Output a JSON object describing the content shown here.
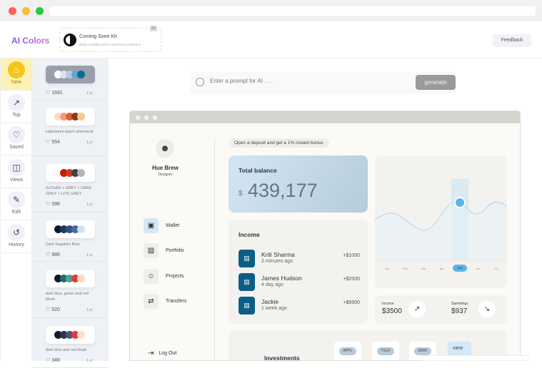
{
  "app": {
    "brand": "AI Colors",
    "feedback_label": "Feedback"
  },
  "ad": {
    "title": "Coming Soon Kit",
    "subtitle": "Build a Waitlist before launching products 2",
    "tag": "Ad"
  },
  "nav": [
    {
      "label": "New",
      "icon": "cake-icon",
      "active": true
    },
    {
      "label": "Top",
      "icon": "trending-up-icon"
    },
    {
      "label": "Saved",
      "icon": "heart-icon"
    },
    {
      "label": "Views",
      "icon": "views-icon"
    },
    {
      "label": "Edit",
      "icon": "pencil-icon"
    },
    {
      "label": "History",
      "icon": "history-icon"
    }
  ],
  "palettes": [
    {
      "name": "",
      "likes": "1691",
      "age": "1 yr",
      "colors": [
        "#ffffff",
        "#d9e6ef",
        "#b3cde0",
        "#5ea8d6",
        "#0a6a93"
      ]
    },
    {
      "name": "Halloween warm whimsical",
      "likes": "554",
      "age": "1 yr",
      "colors": [
        "#f6dcc4",
        "#f0a070",
        "#e0603a",
        "#8a3a18",
        "#f6c890"
      ]
    },
    {
      "name": "#c21d03 + GREY + DARK GREY + LITE GREY",
      "likes": "398",
      "age": "1 yr",
      "colors": [
        "#fbf4f4",
        "#c21d03",
        "#d03a20",
        "#404040",
        "#b5b5b5"
      ]
    },
    {
      "name": "Dark Sapphire Blue",
      "likes": "986",
      "age": "1 yr",
      "colors": [
        "#0f1b2d",
        "#1f3a5f",
        "#34507e",
        "#4a6a9a",
        "#cfe3f7"
      ]
    },
    {
      "name": "dark blue, green and red blush",
      "likes": "520",
      "age": "1 yr",
      "colors": [
        "#0f1b2d",
        "#1b6e6a",
        "#4aa39a",
        "#e53935",
        "#fbd9c0"
      ]
    },
    {
      "name": "dark blue and red blush",
      "likes": "346",
      "age": "1 yr",
      "colors": [
        "#141b2b",
        "#2a3550",
        "#4a5570",
        "#e53935",
        "#fbe0cc"
      ]
    }
  ],
  "prompt": {
    "placeholder": "Enter a prompt for AI . . .",
    "button": "generate"
  },
  "mockup": {
    "profile": {
      "name": "Hue Brew",
      "role": "Designer"
    },
    "menu": [
      {
        "label": "Wallet",
        "icon": "wallet-icon",
        "active": true
      },
      {
        "label": "Portfolio",
        "icon": "chart-icon"
      },
      {
        "label": "Projects",
        "icon": "projects-icon"
      },
      {
        "label": "Transfers",
        "icon": "transfers-icon"
      }
    ],
    "logout": "Log Out",
    "promo": "Open a deposit and get a 1% instant bonus",
    "balance": {
      "title": "Total balance",
      "currency": "$",
      "amount": "439,177"
    },
    "income": {
      "title": "Income",
      "items": [
        {
          "name": "Kriti Sharma",
          "time": "2 minutes ago",
          "amount": "+$1000"
        },
        {
          "name": "James Hudson",
          "time": "4 day ago",
          "amount": "+$2500"
        },
        {
          "name": "Jackie",
          "time": "1 week ago",
          "amount": "+$6900"
        }
      ]
    },
    "chart": {
      "months": [
        "Jan",
        "Feb",
        "Mar",
        "Apr",
        "May",
        "Jun",
        "Jul"
      ],
      "selected": "May"
    },
    "stats": {
      "income_label": "Income",
      "income_value": "$3500",
      "spend_label": "Spendings",
      "spend_value": "$937"
    },
    "investments": {
      "title": "Investments",
      "stocks": [
        "APPL",
        "TSLA",
        "EBAY"
      ],
      "view": "view"
    }
  }
}
